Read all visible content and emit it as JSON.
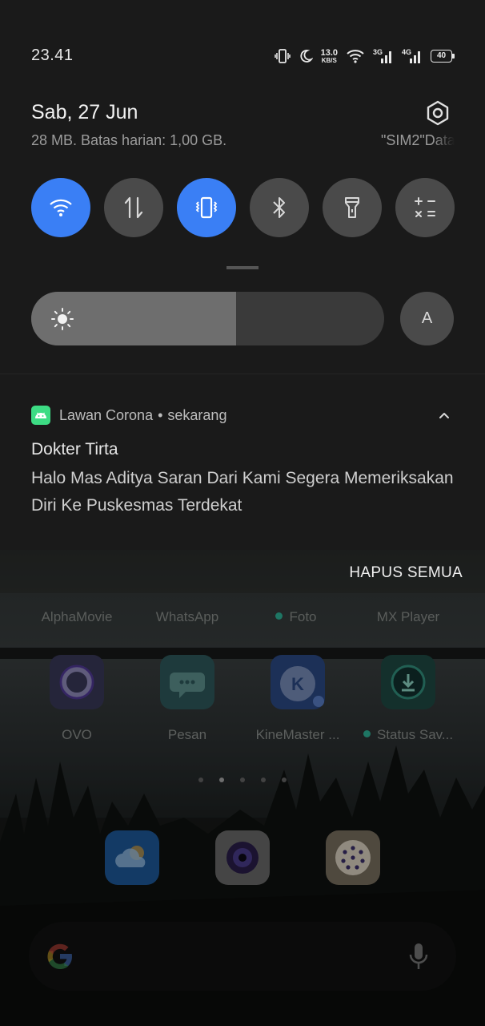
{
  "status_bar": {
    "time": "23.41",
    "net_speed_value": "13.0",
    "net_speed_unit": "KB/S",
    "sim1_type": "3G",
    "sim2_type": "4G",
    "battery": "40"
  },
  "shade": {
    "date": "Sab, 27 Jun",
    "data_usage": "28 MB. Batas harian: 1,00 GB.",
    "sim_label": "\"SIM2\"Data",
    "tiles": [
      {
        "name": "wifi",
        "active": true
      },
      {
        "name": "mobile-data",
        "active": false
      },
      {
        "name": "vibrate",
        "active": true
      },
      {
        "name": "bluetooth",
        "active": false
      },
      {
        "name": "flashlight",
        "active": false
      },
      {
        "name": "calculator",
        "active": false
      }
    ],
    "brightness_level": 0.58,
    "auto_brightness_label": "A",
    "accent": "#3a7ff5"
  },
  "notification": {
    "app": "Lawan Corona",
    "time": "sekarang",
    "separator": "•",
    "title": "Dokter Tirta",
    "body": "Halo Mas Aditya Saran Dari Kami Segera Memeriksakan Diri Ke Puskesmas Terdekat",
    "app_icon": "android-icon"
  },
  "clear_all_label": "HAPUS SEMUA",
  "home": {
    "dock_labels": [
      "AlphaMovie",
      "WhatsApp",
      "Foto",
      "MX Player"
    ],
    "apps": [
      "OVO",
      "Pesan",
      "KineMaster ...",
      "Status Sav..."
    ],
    "page_count": 5,
    "current_page": 2,
    "dock_icons": [
      "weather-icon",
      "camera-icon",
      "app-drawer-icon"
    ]
  }
}
